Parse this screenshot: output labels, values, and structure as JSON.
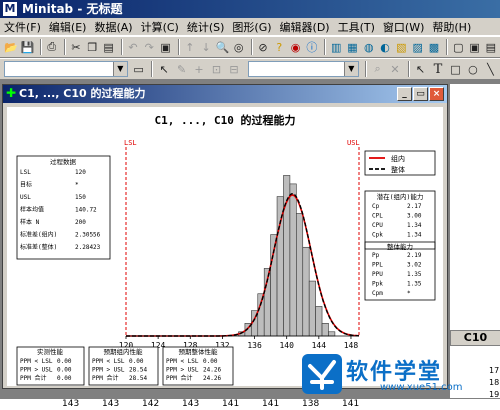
{
  "app": {
    "logo": "M",
    "title": "Minitab - 无标题"
  },
  "menu": [
    {
      "label": "文件(F)"
    },
    {
      "label": "编辑(E)"
    },
    {
      "label": "数据(A)"
    },
    {
      "label": "计算(C)"
    },
    {
      "label": "统计(S)"
    },
    {
      "label": "图形(G)"
    },
    {
      "label": "编辑器(D)"
    },
    {
      "label": "工具(T)"
    },
    {
      "label": "窗口(W)"
    },
    {
      "label": "帮助(H)"
    }
  ],
  "graph_window": {
    "title": "C1, ..., C10 的过程能力",
    "min_label": "_",
    "restore_label": "▭",
    "close_label": "×"
  },
  "chart_data": {
    "type": "bar",
    "title": "C1, ..., C10 的过程能力",
    "x_ticks": [
      120,
      124,
      128,
      132,
      136,
      140,
      144,
      148
    ],
    "xlim": [
      120,
      149
    ],
    "lsl": 120,
    "usl": 149,
    "lsl_label": "LSL",
    "usl_label": "USL",
    "bins": [
      {
        "x0": 134.0,
        "x1": 134.8,
        "count": 1
      },
      {
        "x0": 134.8,
        "x1": 135.6,
        "count": 3
      },
      {
        "x0": 135.6,
        "x1": 136.4,
        "count": 6
      },
      {
        "x0": 136.4,
        "x1": 137.2,
        "count": 10
      },
      {
        "x0": 137.2,
        "x1": 138.0,
        "count": 16
      },
      {
        "x0": 138.0,
        "x1": 138.8,
        "count": 24
      },
      {
        "x0": 138.8,
        "x1": 139.6,
        "count": 33
      },
      {
        "x0": 139.6,
        "x1": 140.4,
        "count": 38
      },
      {
        "x0": 140.4,
        "x1": 141.2,
        "count": 36
      },
      {
        "x0": 141.2,
        "x1": 142.0,
        "count": 29
      },
      {
        "x0": 142.0,
        "x1": 142.8,
        "count": 21
      },
      {
        "x0": 142.8,
        "x1": 143.6,
        "count": 13
      },
      {
        "x0": 143.6,
        "x1": 144.4,
        "count": 7
      },
      {
        "x0": 144.4,
        "x1": 145.2,
        "count": 3
      },
      {
        "x0": 145.2,
        "x1": 146.0,
        "count": 1
      }
    ],
    "mean": 140.72,
    "sd_within": 2.30556,
    "sd_overall": 2.28423,
    "ymax": 40,
    "legend": [
      {
        "name": "组内",
        "style": "solid",
        "color": "#e00000"
      },
      {
        "name": "整体",
        "style": "dashed",
        "color": "#000000"
      }
    ]
  },
  "process_data": {
    "heading": "过程数据",
    "rows": [
      {
        "k": "LSL",
        "v": "120"
      },
      {
        "k": "目标",
        "v": "*"
      },
      {
        "k": "USL",
        "v": "150"
      },
      {
        "k": "样本均值",
        "v": "140.72"
      },
      {
        "k": "样本 N",
        "v": "200"
      },
      {
        "k": "标准差(组内)",
        "v": "2.30556"
      },
      {
        "k": "标准差(整体)",
        "v": "2.28423"
      }
    ]
  },
  "potential": {
    "heading": "潜在(组内)能力",
    "rows": [
      {
        "k": "Cp",
        "v": "2.17"
      },
      {
        "k": "CPL",
        "v": "3.00"
      },
      {
        "k": "CPU",
        "v": "1.34"
      },
      {
        "k": "Cpk",
        "v": "1.34"
      }
    ]
  },
  "overall": {
    "heading": "整体能力",
    "rows": [
      {
        "k": "Pp",
        "v": "2.19"
      },
      {
        "k": "PPL",
        "v": "3.02"
      },
      {
        "k": "PPU",
        "v": "1.35"
      },
      {
        "k": "Ppk",
        "v": "1.35"
      },
      {
        "k": "Cpm",
        "v": "*"
      }
    ]
  },
  "observed": {
    "heading": "实测性能",
    "rows": [
      {
        "k": "PPM < LSL",
        "v": "0.00"
      },
      {
        "k": "PPM > USL",
        "v": "0.00"
      },
      {
        "k": "PPM 合计",
        "v": "0.00"
      }
    ]
  },
  "exp_within": {
    "heading": "预期组内性能",
    "rows": [
      {
        "k": "PPM < LSL",
        "v": "0.00"
      },
      {
        "k": "PPM > USL",
        "v": "28.54"
      },
      {
        "k": "PPM 合计",
        "v": "28.54"
      }
    ]
  },
  "exp_overall": {
    "heading": "预期整体性能",
    "rows": [
      {
        "k": "PPM < LSL",
        "v": "0.00"
      },
      {
        "k": "PPM > USL",
        "v": "24.26"
      },
      {
        "k": "PPM 合计",
        "v": "24.26"
      }
    ]
  },
  "worksheet": {
    "col_label": "C10",
    "row_numbers": [
      "17",
      "18",
      "19"
    ],
    "bottom_values": [
      "143",
      "143",
      "142",
      "143",
      "141",
      "141",
      "138",
      "141"
    ]
  },
  "watermark": {
    "text": "软件学堂",
    "url": "www.xue51.com"
  }
}
